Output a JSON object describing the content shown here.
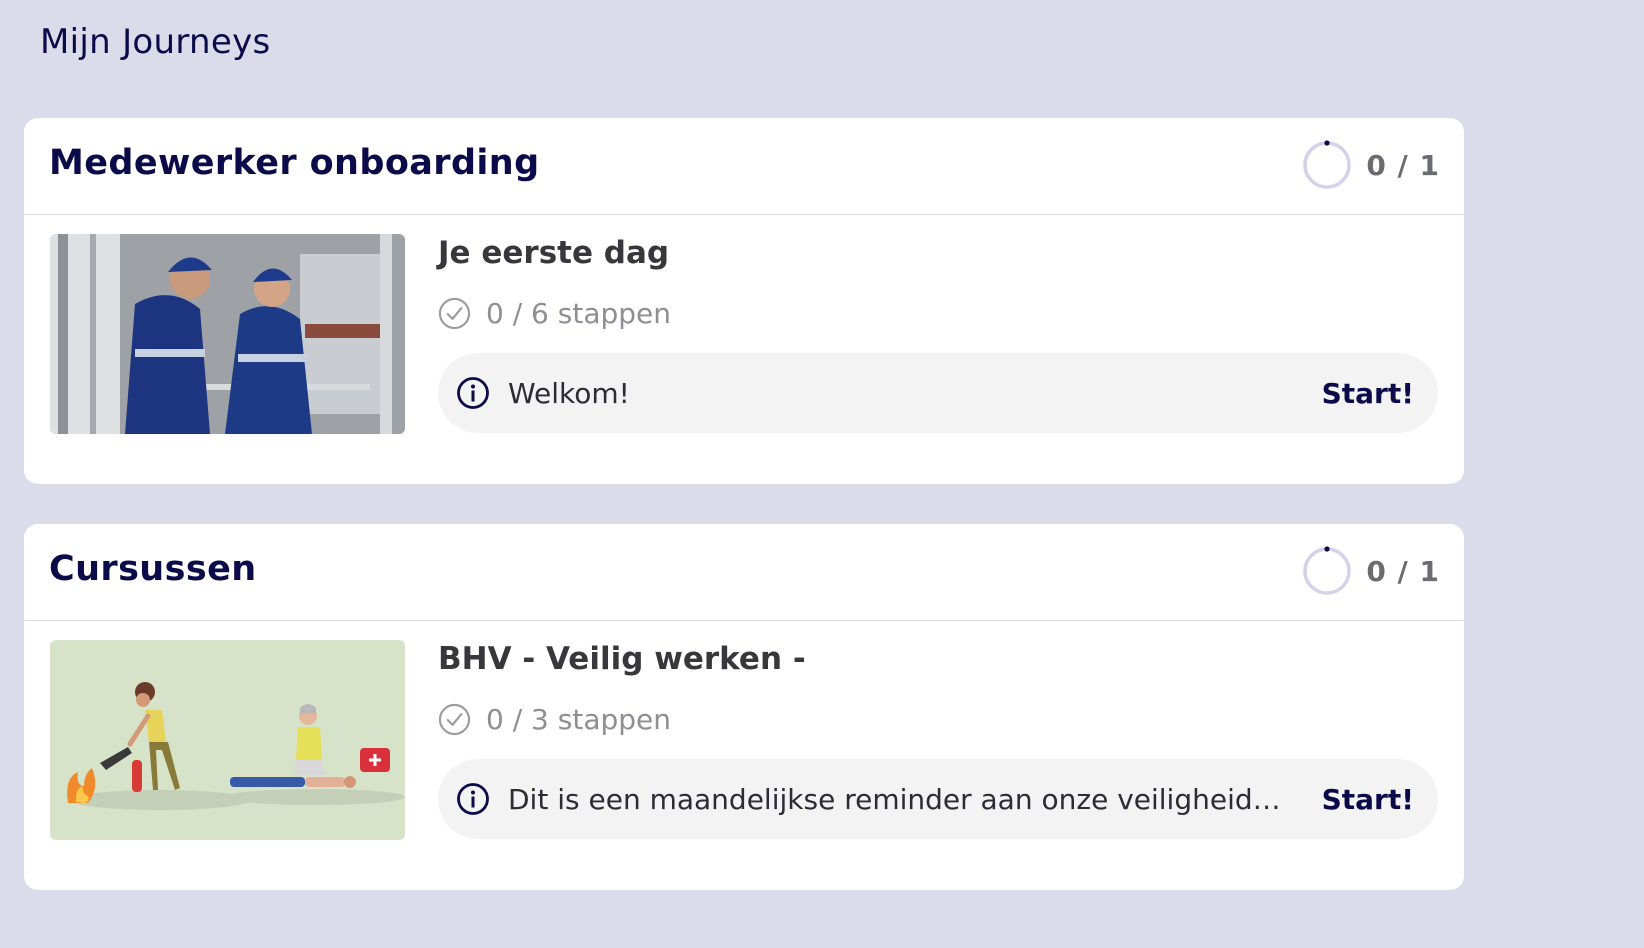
{
  "page": {
    "title": "Mijn Journeys"
  },
  "journeys": [
    {
      "title": "Medewerker onboarding",
      "progress_text": "0 / 1",
      "progress": {
        "completed": 0,
        "total": 1
      },
      "item": {
        "title": "Je eerste dag",
        "steps_text": "0 / 6 stappen",
        "next_step": "Welkom!",
        "action_label": "Start!"
      }
    },
    {
      "title": "Cursussen",
      "progress_text": "0 / 1",
      "progress": {
        "completed": 0,
        "total": 1
      },
      "item": {
        "title": "BHV - Veilig werken -",
        "steps_text": "0 / 3 stappen",
        "next_step": "Dit is een maandelijkse reminder aan onze veiligheidsprotocollen",
        "action_label": "Start!"
      }
    }
  ],
  "icons": {
    "progress": "progress-ring-icon",
    "steps": "check-circle-icon",
    "info": "info-icon"
  },
  "colors": {
    "background": "#dcdbea",
    "brand": "#0b0b4a",
    "ring_track": "#d4d2e8",
    "step_bar": "#f3f3f4"
  }
}
